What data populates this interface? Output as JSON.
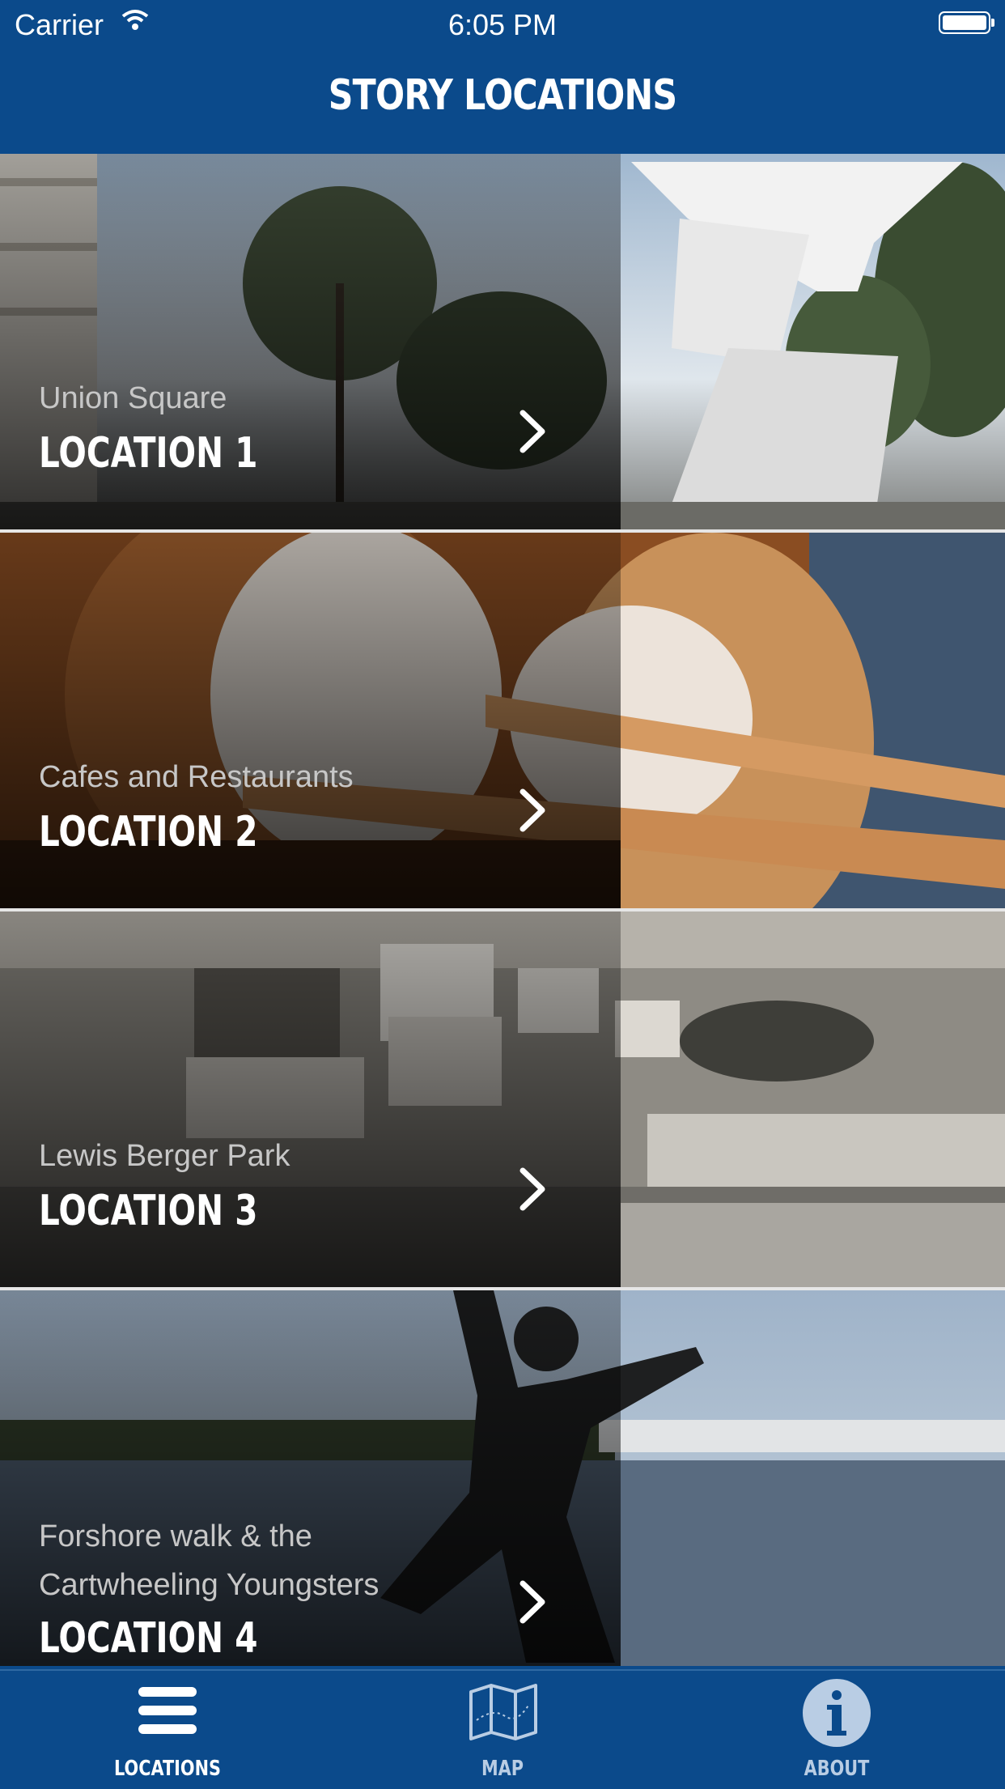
{
  "status_bar": {
    "carrier": "Carrier",
    "time": "6:05 PM"
  },
  "header": {
    "title": "STORY LOCATIONS"
  },
  "locations": [
    {
      "subtitle_lines": [
        "Union Square"
      ],
      "label": "LOCATION 1",
      "icon": "chevron-right-icon"
    },
    {
      "subtitle_lines": [
        "Cafes and Restaurants"
      ],
      "label": "LOCATION 2",
      "icon": "chevron-right-icon"
    },
    {
      "subtitle_lines": [
        "Lewis Berger Park"
      ],
      "label": "LOCATION 3",
      "icon": "chevron-right-icon"
    },
    {
      "subtitle_lines": [
        "Forshore walk & the",
        "Cartwheeling Youngsters"
      ],
      "label": "LOCATION 4",
      "icon": "chevron-right-icon"
    }
  ],
  "tabbar": {
    "items": [
      {
        "label": "LOCATIONS",
        "icon": "menu-icon",
        "active": true
      },
      {
        "label": "MAP",
        "icon": "map-icon",
        "active": false
      },
      {
        "label": "ABOUT",
        "icon": "info-icon",
        "active": false
      }
    ]
  },
  "colors": {
    "brand": "#0b4a8b",
    "tab_inactive": "#b9cde4",
    "row_divider": "#e6e6e6"
  }
}
